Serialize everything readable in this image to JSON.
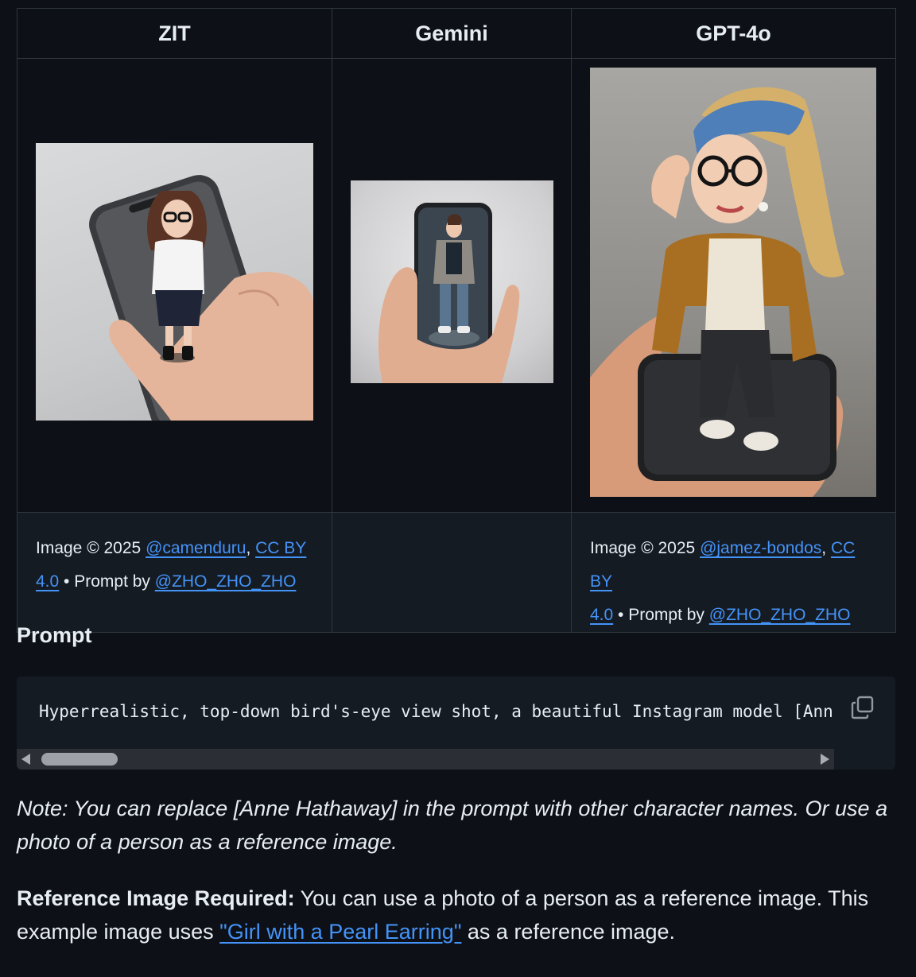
{
  "table": {
    "headers": [
      "ZIT",
      "Gemini",
      "GPT-4o"
    ],
    "credits": {
      "zit": {
        "prefix": "Image © 2025 ",
        "author": "@camenduru",
        "sep": ", ",
        "license_a": "CC BY",
        "license_b": "4.0",
        "mid": " • Prompt by ",
        "prompt_author": "@ZHO_ZHO_ZHO"
      },
      "gemini": {},
      "gpt": {
        "prefix": "Image © 2025 ",
        "author": "@jamez-bondos",
        "sep": ", ",
        "license_a": "CC BY",
        "license_b": "4.0",
        "mid": " • Prompt by ",
        "prompt_author": "@ZHO_ZHO_ZHO"
      }
    }
  },
  "prompt": {
    "title": "Prompt",
    "code": "Hyperrealistic, top-down bird's-eye view shot, a beautiful Instagram model [Anne Hathaway]",
    "copy_icon": "copy-icon"
  },
  "note": "Note: You can replace [Anne Hathaway] in the prompt with other character names. Or use a photo of a person as a reference image.",
  "reference": {
    "bold": "Reference Image Required:",
    "text": " You can use a photo of a person as a reference image. This example image uses ",
    "link": "\"Girl with a Pearl Earring\"",
    "tail": " as a reference image."
  },
  "colors": {
    "background": "#0d1117",
    "link": "#4493f8",
    "border": "#30363d"
  }
}
